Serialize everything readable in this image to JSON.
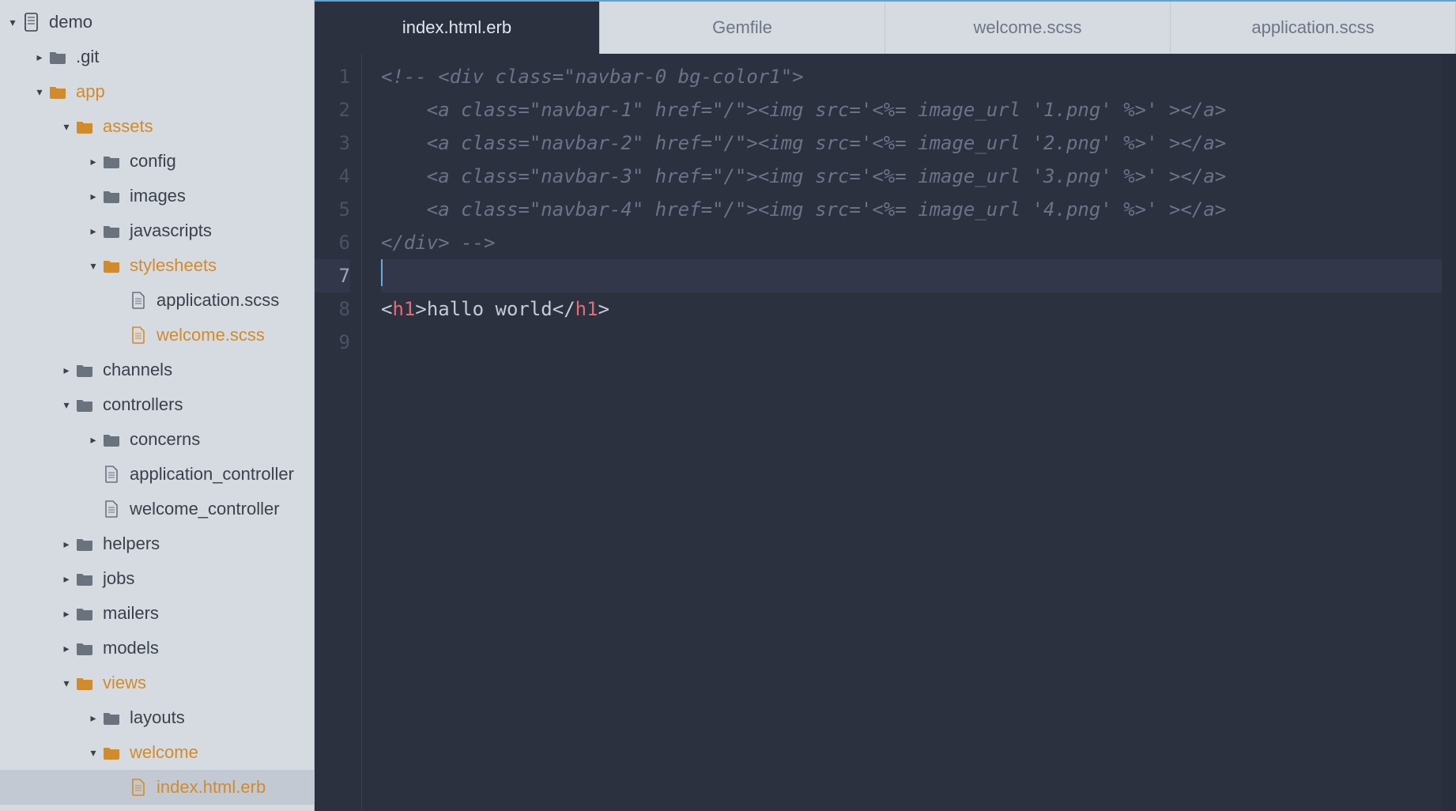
{
  "project_root": "demo",
  "tree": {
    "git": ".git",
    "app": "app",
    "assets": "assets",
    "config": "config",
    "images": "images",
    "javascripts": "javascripts",
    "stylesheets": "stylesheets",
    "application_scss": "application.scss",
    "welcome_scss": "welcome.scss",
    "channels": "channels",
    "controllers": "controllers",
    "concerns": "concerns",
    "application_controller": "application_controller",
    "welcome_controller": "welcome_controller",
    "helpers": "helpers",
    "jobs": "jobs",
    "mailers": "mailers",
    "models": "models",
    "views": "views",
    "layouts": "layouts",
    "welcome_folder": "welcome",
    "index_html_erb": "index.html.erb"
  },
  "tabs": [
    {
      "label": "index.html.erb",
      "active": true
    },
    {
      "label": "Gemfile",
      "active": false
    },
    {
      "label": "welcome.scss",
      "active": false
    },
    {
      "label": "application.scss",
      "active": false
    }
  ],
  "code": {
    "l1": "<!-- <div class=\"navbar-0 bg-color1\">",
    "l2": "    <a class=\"navbar-1\" href=\"/\"><img src='<%= image_url '1.png' %>' ></a>",
    "l3": "    <a class=\"navbar-2\" href=\"/\"><img src='<%= image_url '2.png' %>' ></a>",
    "l4": "    <a class=\"navbar-3\" href=\"/\"><img src='<%= image_url '3.png' %>' ></a>",
    "l5": "    <a class=\"navbar-4\" href=\"/\"><img src='<%= image_url '4.png' %>' ></a>",
    "l6": "</div> -->",
    "l7": "",
    "l8_open": "<",
    "l8_tag": "h1",
    "l8_mid": ">",
    "l8_text": "hallo world",
    "l8_close1": "</",
    "l8_close2": ">",
    "l9": ""
  },
  "line_numbers": [
    "1",
    "2",
    "3",
    "4",
    "5",
    "6",
    "7",
    "8",
    "9"
  ]
}
